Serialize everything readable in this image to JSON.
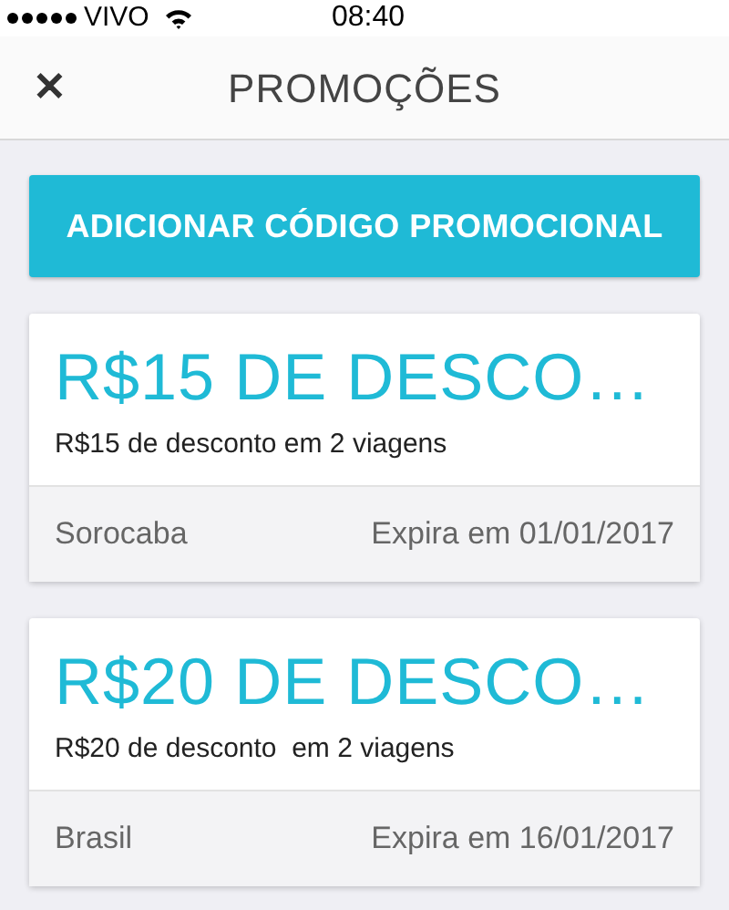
{
  "status_bar": {
    "carrier": "VIVO",
    "time": "08:40"
  },
  "header": {
    "close": "✕",
    "title": "PROMOÇÕES"
  },
  "add_button": "ADICIONAR CÓDIGO PROMOCIONAL",
  "promos": [
    {
      "headline": "R$15 DE DESCO…",
      "description": "R$15 de desconto em 2 viagens",
      "region": "Sorocaba",
      "expiry": "Expira em 01/01/2017"
    },
    {
      "headline": "R$20 DE DESCO…",
      "description": "R$20 de desconto  em 2 viagens",
      "region": "Brasil",
      "expiry": "Expira em 16/01/2017"
    }
  ]
}
